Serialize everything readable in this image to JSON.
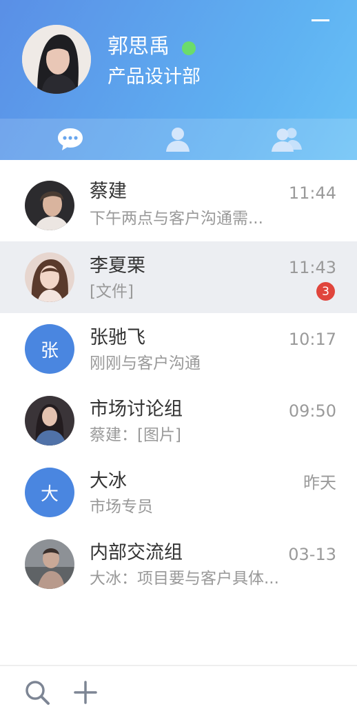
{
  "profile": {
    "name": "郭思禹",
    "department": "产品设计部",
    "status_color": "#6bdc6b"
  },
  "tabs": [
    {
      "icon": "chat-bubble-icon",
      "active": true
    },
    {
      "icon": "contact-person-icon",
      "active": false
    },
    {
      "icon": "group-icon",
      "active": false
    }
  ],
  "conversations": [
    {
      "name": "蔡建",
      "preview": "下午两点与客户沟通需...",
      "time": "11:44"
    },
    {
      "name": "李夏栗",
      "preview": "[文件]",
      "time": "11:43",
      "unread": "3"
    },
    {
      "name": "张驰飞",
      "preview": "刚刚与客户沟通",
      "time": "10:17",
      "initial": "张"
    },
    {
      "name": "市场讨论组",
      "preview": "蔡建：[图片]",
      "time": "09:50"
    },
    {
      "name": "大冰",
      "preview": "市场专员",
      "time": "昨天",
      "initial": "大"
    },
    {
      "name": "内部交流组",
      "preview": "大冰：项目要与客户具体...",
      "time": "03-13"
    }
  ],
  "footer": {
    "icons": [
      "search-icon",
      "add-icon"
    ]
  },
  "colors": {
    "accent": "#4a86e0",
    "badge": "#e0453c",
    "selected_row": "#eceef2",
    "tab_active": "#ffffff",
    "tab_inactive": "#d4e6fb"
  }
}
